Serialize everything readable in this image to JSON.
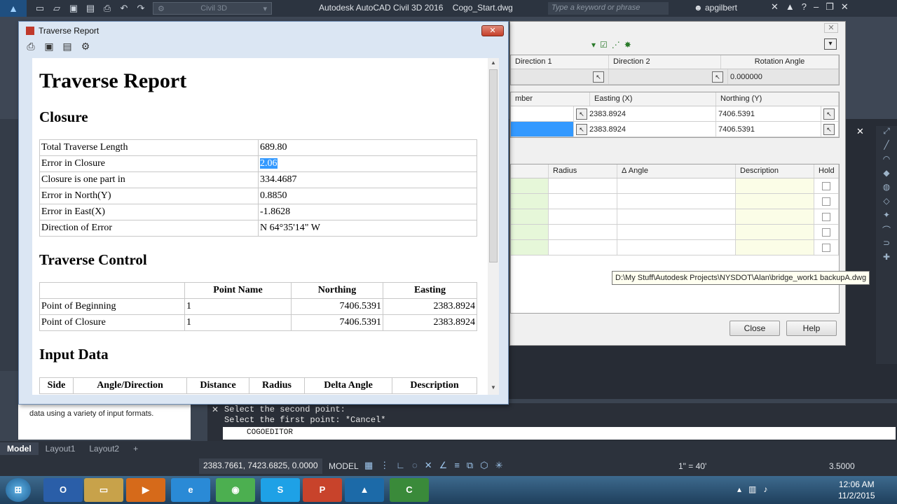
{
  "acad": {
    "title": "Autodesk AutoCAD Civil 3D 2016",
    "doc": "Cogo_Start.dwg",
    "search_placeholder": "Type a keyword or phrase",
    "user": "apgilbert",
    "workspace": "Civil 3D"
  },
  "cogo_editor": {
    "top_grid": {
      "headers": [
        "Direction 1",
        "Direction 2",
        "Rotation Angle"
      ],
      "rotation_value": "0.000000"
    },
    "point_grid": {
      "headers": [
        "mber",
        "Easting (X)",
        "Northing (Y)"
      ],
      "rows": [
        {
          "easting": "2383.8924",
          "northing": "7406.5391"
        },
        {
          "easting": "2383.8924",
          "northing": "7406.5391"
        }
      ]
    },
    "data_grid": {
      "headers": [
        "Radius",
        "Δ Angle",
        "Description",
        "Hold"
      ]
    },
    "tooltip": "D:\\My Stuff\\Autodesk Projects\\NYSDOT\\Alan\\bridge_work1 backupA.dwg",
    "close_label": "Close",
    "help_label": "Help"
  },
  "report": {
    "window_title": "Traverse Report",
    "heading": "Traverse Report",
    "closure_heading": "Closure",
    "closure_rows": [
      {
        "label": "Total Traverse Length",
        "value": "689.80"
      },
      {
        "label": "Error in Closure",
        "value": "2.06"
      },
      {
        "label": "Closure is one part in",
        "value": "334.4687"
      },
      {
        "label": "Error in North(Y)",
        "value": "0.8850"
      },
      {
        "label": "Error in East(X)",
        "value": "-1.8628"
      },
      {
        "label": "Direction of Error",
        "value": "N 64°35'14\" W"
      }
    ],
    "control_heading": "Traverse Control",
    "control_headers": [
      "Point Name",
      "Northing",
      "Easting"
    ],
    "control_rows": [
      {
        "label": "Point of Beginning",
        "name": "1",
        "northing": "7406.5391",
        "easting": "2383.8924"
      },
      {
        "label": "Point of Closure",
        "name": "1",
        "northing": "7406.5391",
        "easting": "2383.8924"
      }
    ],
    "input_heading": "Input Data",
    "input_headers": [
      "Side",
      "Angle/Direction",
      "Distance",
      "Radius",
      "Delta Angle",
      "Description"
    ]
  },
  "help_panel": {
    "text": "data using a variety of input formats."
  },
  "command_line": {
    "history": [
      "Select the second point:",
      "Select the first point: *Cancel*"
    ],
    "current": "COGOEDITOR"
  },
  "layout_tabs": [
    "Model",
    "Layout1",
    "Layout2",
    "+"
  ],
  "statusbar": {
    "coords": "2383.7661, 7423.6825, 0.0000",
    "model": "MODEL",
    "scale": "1\" = 40'",
    "lineweight": "3.5000"
  },
  "taskbar": {
    "apps": [
      "Outlook",
      "Explorer",
      "Media",
      "IE",
      "Chrome",
      "Skype",
      "PowerPoint",
      "Civil 3D",
      "Camtasia"
    ],
    "time": "12:06 AM",
    "date": "11/2/2015"
  }
}
